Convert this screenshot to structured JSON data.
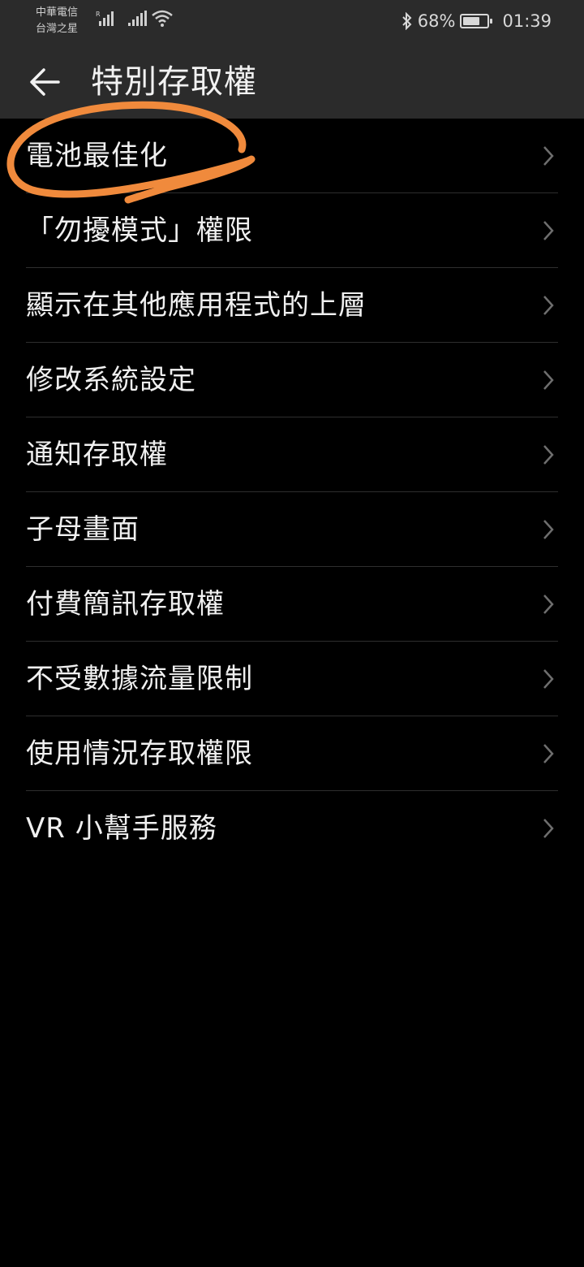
{
  "status_bar": {
    "carrier_1": "中華電信",
    "carrier_2": "台灣之星",
    "battery_percent": "68%",
    "battery_level": 0.68,
    "time": "01:39"
  },
  "header": {
    "title": "特別存取權"
  },
  "list": {
    "items": [
      {
        "label": "電池最佳化"
      },
      {
        "label": "「勿擾模式」權限"
      },
      {
        "label": "顯示在其他應用程式的上層"
      },
      {
        "label": "修改系統設定"
      },
      {
        "label": "通知存取權"
      },
      {
        "label": "子母畫面"
      },
      {
        "label": "付費簡訊存取權"
      },
      {
        "label": "不受數據流量限制"
      },
      {
        "label": "使用情況存取權限"
      },
      {
        "label": "VR 小幫手服務"
      }
    ]
  },
  "colors": {
    "background": "#000000",
    "bar": "#2b2b2b",
    "annotation": "#f08a3c"
  }
}
